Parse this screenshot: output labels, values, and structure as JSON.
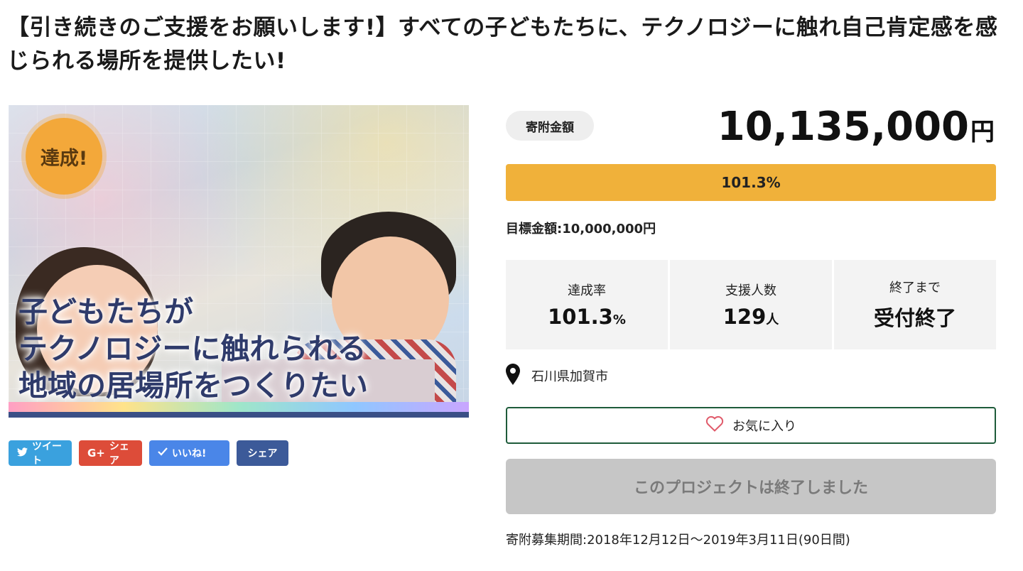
{
  "project": {
    "title": "【引き続きのご支援をお願いします!】すべての子どもたちに、テクノロジーに触れ自己肯定感を感じられる場所を提供したい!"
  },
  "hero": {
    "badge": "達成!",
    "text": "子どもたちが\nテクノロジーに触れられる\n地域の居場所をつくりたい"
  },
  "social": {
    "tweet": "ツイート",
    "gplus_icon": "G+",
    "gplus": "シェア",
    "like": "いいね!",
    "fb_share": "シェア"
  },
  "donation": {
    "label": "寄附金額",
    "amount": "10,135,000",
    "unit": "円",
    "progress_text": "101.3%",
    "progress_fraction": 1.0,
    "goal": "目標金額:10,000,000円"
  },
  "stats": {
    "rate_label": "達成率",
    "rate_value": "101.3",
    "rate_unit": "%",
    "supporters_label": "支援人数",
    "supporters_value": "129",
    "supporters_unit": "人",
    "remaining_label": "終了まで",
    "remaining_value": "受付終了"
  },
  "location": "石川県加賀市",
  "favorite_label": "お気に入り",
  "ended_label": "このプロジェクトは終了しました",
  "period": "寄附募集期間:2018年12月12日〜2019年3月11日(90日間)",
  "colors": {
    "progress": "#f0b13a",
    "favorite_border": "#1e5b3a",
    "ended_bg": "#c6c6c6"
  }
}
